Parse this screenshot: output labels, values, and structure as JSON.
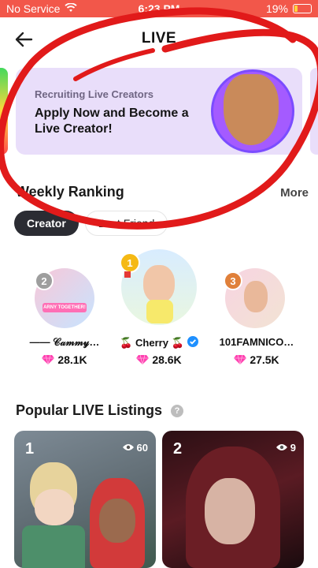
{
  "status_bar": {
    "carrier": "No Service",
    "time": "6:23 PM",
    "battery": "19%",
    "battery_level": 0.19
  },
  "header": {
    "title": "LIVE"
  },
  "banner": {
    "subtitle": "Recruiting Live Creators",
    "headline": "Apply Now and Become a Live Creator!"
  },
  "ranking": {
    "title": "Weekly Ranking",
    "more": "More",
    "tabs": [
      "Creator",
      "Best Friend"
    ],
    "entries": [
      {
        "rank": "2",
        "name": "—— 𝒞𝒶𝓂𝓂𝓎…",
        "score": "28.1K",
        "avatar_caption": "ARNY TOGETHER!"
      },
      {
        "rank": "1",
        "name": "🍒 Cherry 🍒",
        "score": "28.6K"
      },
      {
        "rank": "3",
        "name": "101FAMNICO…",
        "score": "27.5K"
      }
    ]
  },
  "popular": {
    "title": "Popular LIVE Listings",
    "help_glyph": "?",
    "listings": [
      {
        "rank": "1",
        "viewers": "60"
      },
      {
        "rank": "2",
        "viewers": "9"
      }
    ]
  },
  "colors": {
    "status_bar": "#f2574a",
    "banner_bg": "#e9defa",
    "tab_active": "#2b2c33",
    "gem": "#ff3fb0",
    "gold": "#f5b914",
    "silver": "#9e9e9e",
    "bronze": "#e0803a",
    "verified": "#1e90ff",
    "scribble": "#e11a1a"
  }
}
